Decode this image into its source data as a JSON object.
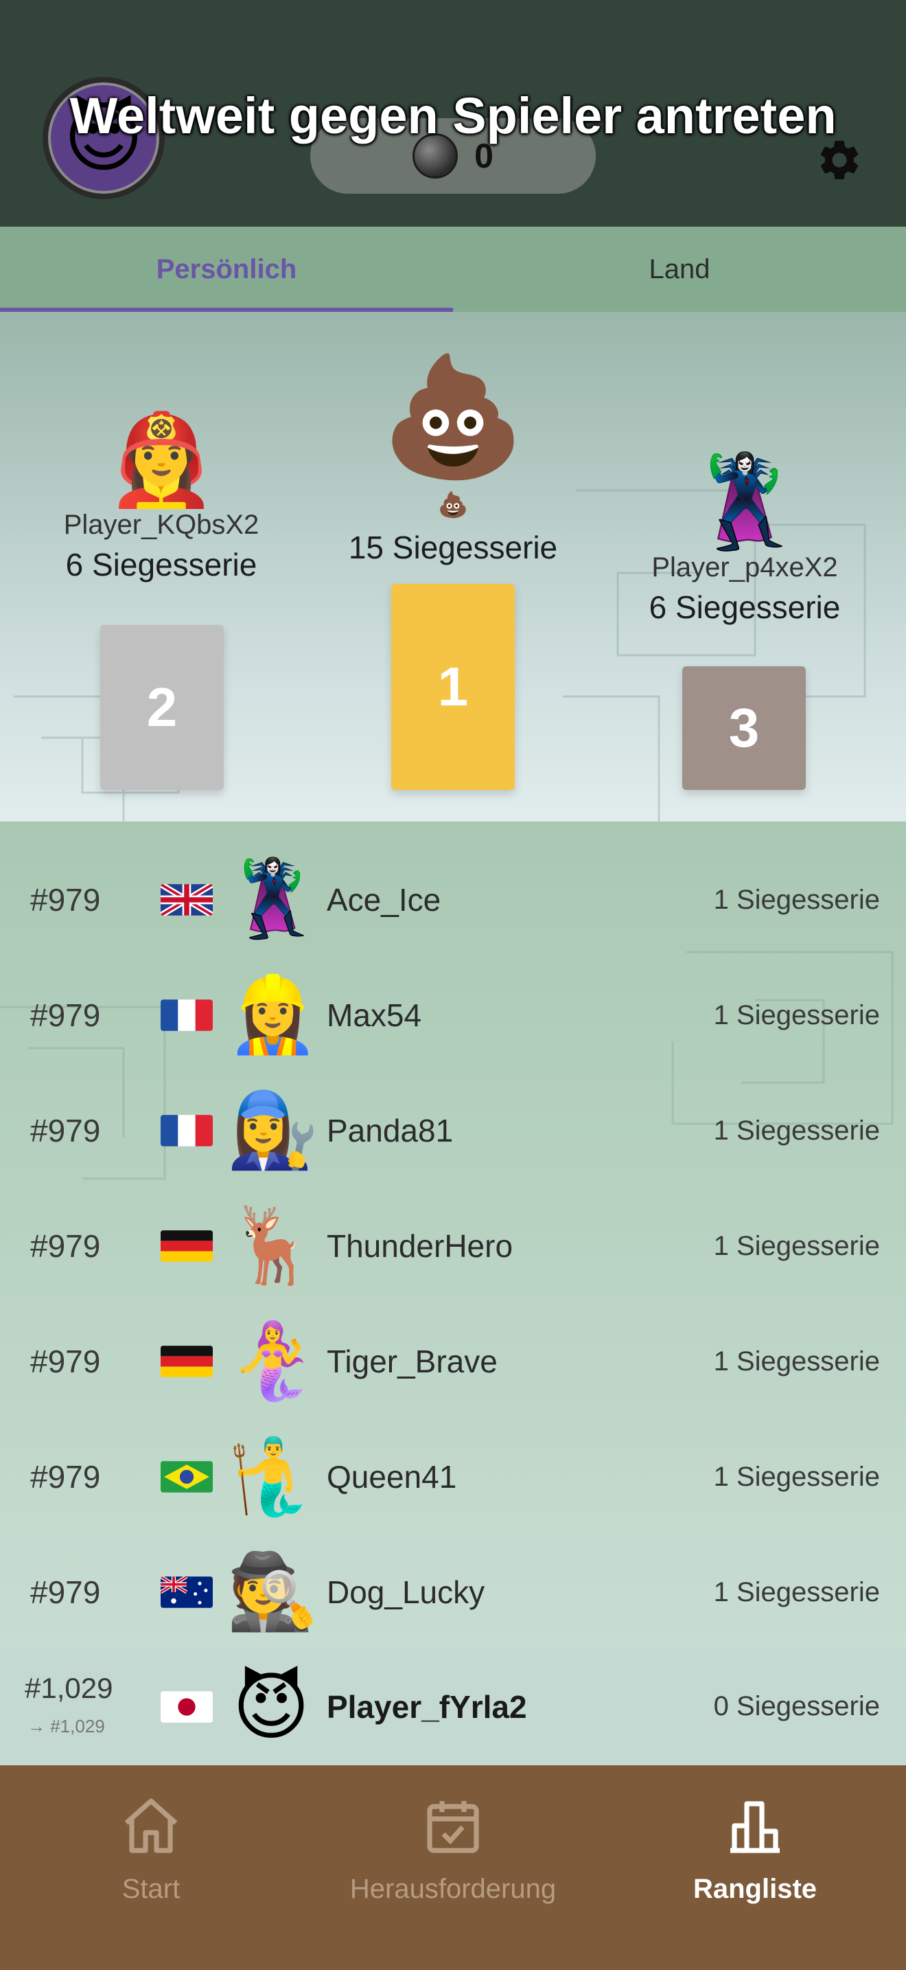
{
  "header": {
    "title": "Weltweit gegen Spieler antreten",
    "avatar_emoji": "😈",
    "coin_count": "0"
  },
  "tabs": [
    {
      "label": "Persönlich",
      "active": true
    },
    {
      "label": "Land",
      "active": false
    }
  ],
  "podium": {
    "first": {
      "emoji": "💩",
      "small_emoji": "💩",
      "name": "",
      "streak": "15 Siegesserie",
      "place": "1",
      "color": "#f5c445"
    },
    "second": {
      "emoji": "👩‍🚒",
      "name": "Player_KQbsX2",
      "streak": "6 Siegesserie",
      "place": "2",
      "color": "#c0c0c0"
    },
    "third": {
      "emoji": "🦹‍♀️",
      "name": "Player_p4xeX2",
      "streak": "6 Siegesserie",
      "place": "3",
      "color": "#a0908a"
    }
  },
  "leaderboard": [
    {
      "rank": "#979",
      "flag": "gb",
      "emoji": "🦹‍♀️",
      "name": "Ace_Ice",
      "streak": "1 Siegesserie"
    },
    {
      "rank": "#979",
      "flag": "fr",
      "emoji": "👷‍♀️",
      "name": "Max54",
      "streak": "1 Siegesserie"
    },
    {
      "rank": "#979",
      "flag": "fr",
      "emoji": "👩‍🔧",
      "name": "Panda81",
      "streak": "1 Siegesserie"
    },
    {
      "rank": "#979",
      "flag": "de",
      "emoji": "🦌",
      "name": "ThunderHero",
      "streak": "1 Siegesserie"
    },
    {
      "rank": "#979",
      "flag": "de",
      "emoji": "🧜‍♀️",
      "name": "Tiger_Brave",
      "streak": "1 Siegesserie"
    },
    {
      "rank": "#979",
      "flag": "br",
      "emoji": "🧜‍♂️",
      "name": "Queen41",
      "streak": "1 Siegesserie"
    },
    {
      "rank": "#979",
      "flag": "au",
      "emoji": "🕵️",
      "name": "Dog_Lucky",
      "streak": "1 Siegesserie"
    }
  ],
  "current_player": {
    "rank": "#1,029",
    "rank_sub": "→ #1,029",
    "flag": "jp",
    "emoji": "😈",
    "name": "Player_fYrla2",
    "streak": "0 Siegesserie"
  },
  "bottom_nav": [
    {
      "label": "Start",
      "icon": "home-icon",
      "active": false
    },
    {
      "label": "Herausforderung",
      "icon": "calendar-check-icon",
      "active": false
    },
    {
      "label": "Rangliste",
      "icon": "bar-chart-icon",
      "active": true
    }
  ]
}
